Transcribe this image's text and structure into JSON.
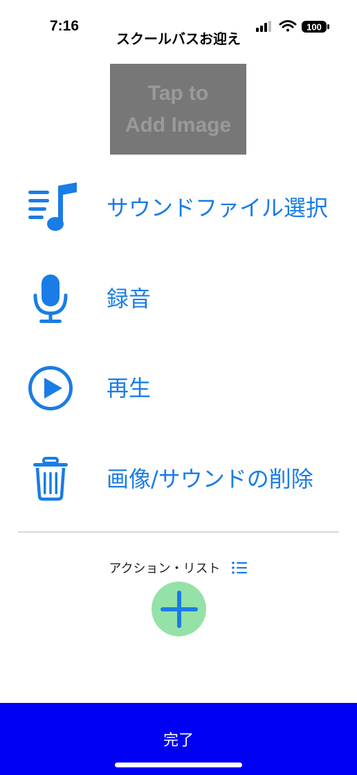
{
  "status_bar": {
    "time": "7:16",
    "battery": "100",
    "signal_icon": "cellular-signal-icon",
    "wifi_icon": "wifi-icon",
    "battery_icon": "battery-icon"
  },
  "nav": {
    "title": "スクールバスお迎え"
  },
  "image_placeholder": {
    "line1": "Tap to",
    "line2": "Add Image"
  },
  "menu": {
    "items": [
      {
        "label": "サウンドファイル選択",
        "icon": "music-list-icon"
      },
      {
        "label": "録音",
        "icon": "microphone-icon"
      },
      {
        "label": "再生",
        "icon": "play-circle-icon"
      },
      {
        "label": "画像/サウンドの削除",
        "icon": "trash-icon"
      }
    ]
  },
  "action_list": {
    "label": "アクション・リスト",
    "icon": "list-icon"
  },
  "add_button": {
    "icon": "plus-icon"
  },
  "done": {
    "label": "完了"
  },
  "colors": {
    "accent": "#1a7ce6",
    "add_button_bg": "#94e2a7",
    "done_bar": "#0000f5",
    "placeholder_bg": "#777777"
  }
}
